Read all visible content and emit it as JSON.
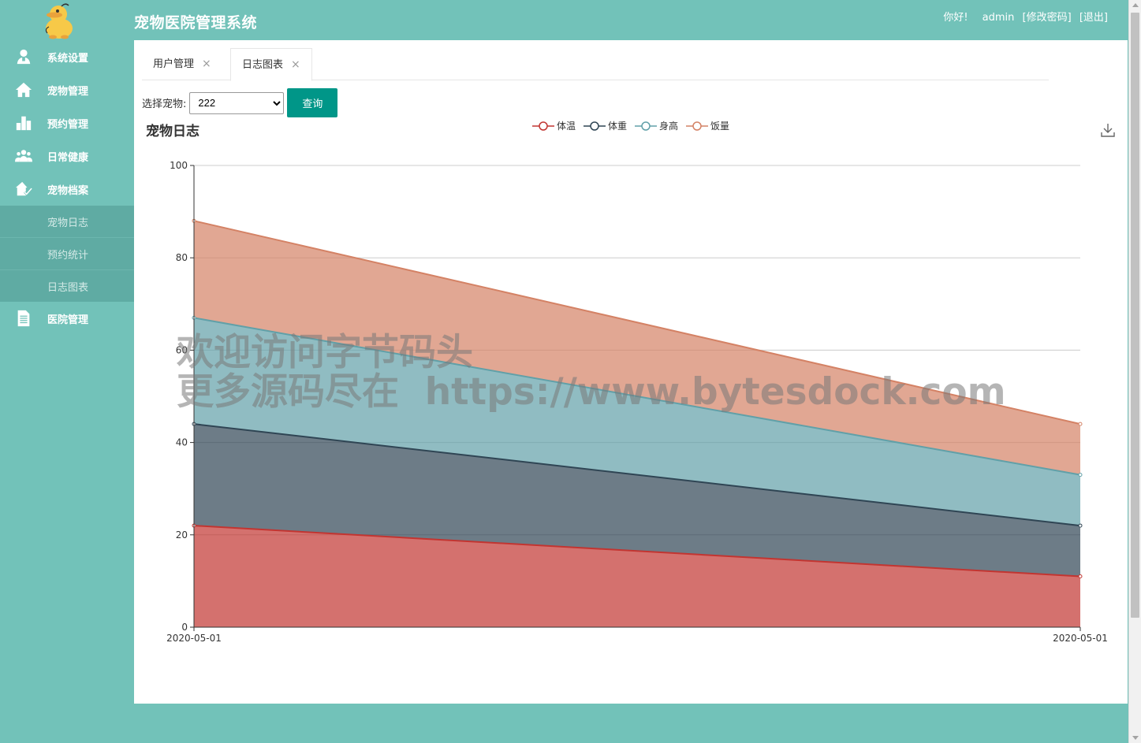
{
  "app": {
    "title": "宠物医院管理系统"
  },
  "user_bar": {
    "greeting": "你好!",
    "username": "admin",
    "change_password": "[修改密码]",
    "logout": "[退出]"
  },
  "sidebar": {
    "items": [
      {
        "label": "系统设置",
        "icon": "user-icon"
      },
      {
        "label": "宠物管理",
        "icon": "home-icon"
      },
      {
        "label": "预约管理",
        "icon": "bar-chart-icon"
      },
      {
        "label": "日常健康",
        "icon": "group-icon"
      },
      {
        "label": "宠物档案",
        "icon": "house-check-icon"
      }
    ],
    "sub_items": [
      {
        "label": "宠物日志"
      },
      {
        "label": "预约统计"
      },
      {
        "label": "日志图表"
      }
    ],
    "last_item": {
      "label": "医院管理",
      "icon": "document-icon"
    }
  },
  "tabs": [
    {
      "label": "用户管理",
      "close": "×",
      "active": false
    },
    {
      "label": "日志图表",
      "close": "×",
      "active": true
    }
  ],
  "filter": {
    "label": "选择宠物:",
    "selected": "222",
    "button": "查询"
  },
  "watermark": {
    "line1": "欢迎访问字节码头",
    "line2": "更多源码尽在  https://www.bytesdock.com"
  },
  "chart_data": {
    "type": "area",
    "stacked": true,
    "title": "宠物日志",
    "categories": [
      "2020-05-01",
      "2020-05-01"
    ],
    "ylim": [
      0,
      100
    ],
    "yticks": [
      0,
      20,
      40,
      60,
      80,
      100
    ],
    "grid": true,
    "legend_position": "top-center",
    "series": [
      {
        "name": "体温",
        "values": [
          22,
          11
        ],
        "color": "#c23531"
      },
      {
        "name": "体重",
        "values": [
          22,
          11
        ],
        "color": "#2f4554"
      },
      {
        "name": "身高",
        "values": [
          23,
          11
        ],
        "color": "#61a0a8"
      },
      {
        "name": "饭量",
        "values": [
          21,
          11
        ],
        "color": "#d48265"
      }
    ]
  }
}
